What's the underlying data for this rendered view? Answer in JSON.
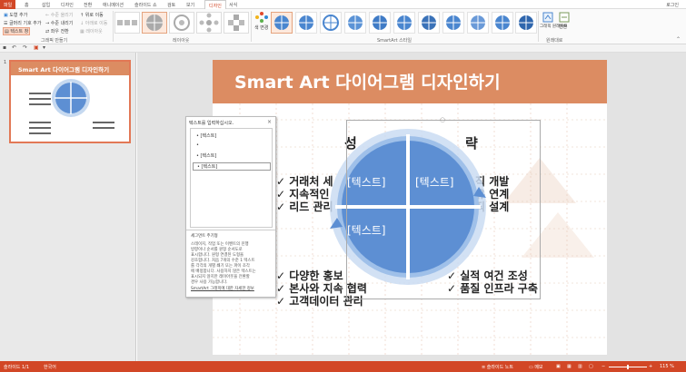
{
  "tabs": {
    "file": "파일",
    "home": "홈",
    "insert": "삽입",
    "design": "디자인",
    "transitions": "전환",
    "animations": "애니메이션",
    "slideshow": "슬라이드 쇼",
    "review": "검토",
    "view": "보기",
    "smartart_design": "디자인",
    "format": "서식"
  },
  "user": "로그인",
  "ribbon": {
    "add_shape": "도형 추가",
    "add_bullet": "글머리 기호 추가",
    "text_pane": "텍스트 창",
    "promote": "수준 올리기",
    "demote": "수준 내리기",
    "right_to_left": "좌우 전환",
    "move_up": "위로 이동",
    "move_down": "아래로 이동",
    "layout_btn": "레이아웃",
    "create_graphic_label": "그래픽 만들기",
    "layouts_label": "레이아웃",
    "change_colors": "색 변경",
    "smartart_styles_label": "SmartArt 스타일",
    "reset_graphic": "그래픽 원래대로",
    "convert": "변환",
    "reset_label": "원래대로"
  },
  "thumbnail": {
    "title": "Smart Art 다이어그램 디자인하기"
  },
  "slide": {
    "title": "Smart Art 다이어그램 디자인하기",
    "center_left": "성",
    "center_right": "략",
    "left_top": [
      "✓ 거래처 세",
      "✓ 지속적인",
      "✓ 리드 관리"
    ],
    "right_top": [
      "직 개발",
      "유 연계",
      "직 설계"
    ],
    "left_bottom": [
      "✓ 다양한 홍보",
      "✓ 본사와 지속 협력",
      "✓ 고객데이터 관리"
    ],
    "right_bottom": [
      "✓ 실적 여건 조성",
      "✓ 품질 인프라 구축"
    ],
    "seg_tl": "[텍스트]",
    "seg_tr": "[텍스트]",
    "seg_bl": "[텍스트]"
  },
  "textpane": {
    "header": "텍스트를 입력하십시오.",
    "close": "×",
    "items": [
      "[텍스트]",
      "",
      "[텍스트]",
      "[텍스트]"
    ],
    "info_title": "세그먼트 주기형",
    "info_lines": [
      "스테이지, 작업 또는 이벤트의 진행",
      "방향이나 순서를 원형 순서도로",
      "표시합니다. 원형 연결된 도형을",
      "강조합니다. 처음 7개의 수준 1 텍스트",
      "를 각각의 개별 쐐기 또는 파이 조각",
      "에 배정합니다. 사용하지 않은 텍스트는",
      "표시되지 않지만 레이아웃을 전환할",
      "경우 사용 가능합니다."
    ],
    "info_link": "SmartArt 그래픽에 대한 자세한 정보"
  },
  "status": {
    "slide_info": "슬라이드 1/1",
    "language": "한국어",
    "notes": "슬라이드 노트",
    "comments": "메모",
    "zoom": "115 %"
  },
  "colors": {
    "accent": "#d24726",
    "title_band": "#dc8c62",
    "segment": "#5d8fd3",
    "ring": "#aac6ea"
  }
}
